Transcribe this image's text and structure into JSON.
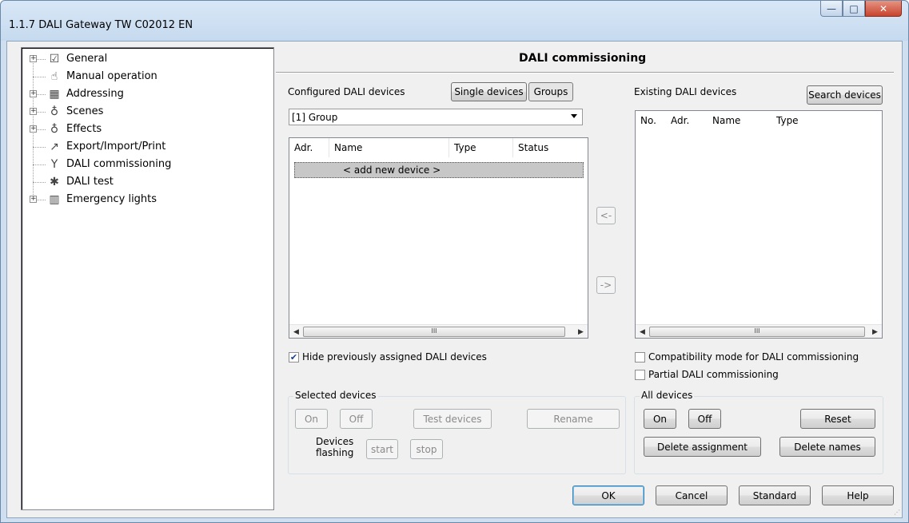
{
  "window": {
    "title": "1.1.7 DALI Gateway TW C02012 EN",
    "minimize_glyph": "—",
    "maximize_glyph": "□",
    "close_glyph": "✕"
  },
  "tree": {
    "expander_glyph": "+",
    "items": [
      {
        "label": "General",
        "icon": "checklist-icon",
        "glyph": "☑",
        "expandable": true
      },
      {
        "label": "Manual operation",
        "icon": "hand-icon",
        "glyph": "☝",
        "expandable": false
      },
      {
        "label": "Addressing",
        "icon": "grid-icon",
        "glyph": "▦",
        "expandable": true
      },
      {
        "label": "Scenes",
        "icon": "bulb-icon",
        "glyph": "♁",
        "expandable": true
      },
      {
        "label": "Effects",
        "icon": "bulb-icon",
        "glyph": "♁",
        "expandable": true
      },
      {
        "label": "Export/Import/Print",
        "icon": "export-icon",
        "glyph": "↗",
        "expandable": false
      },
      {
        "label": "DALI commissioning",
        "icon": "wrench-icon",
        "glyph": "Y",
        "expandable": false
      },
      {
        "label": "DALI test",
        "icon": "gear-icon",
        "glyph": "✱",
        "expandable": false
      },
      {
        "label": "Emergency lights",
        "icon": "emergency-exit-icon",
        "glyph": "▥",
        "expandable": true
      }
    ]
  },
  "main": {
    "heading": "DALI commissioning",
    "configured": {
      "label": "Configured DALI devices",
      "tab_single": "Single devices",
      "tab_groups": "Groups",
      "group_select": "[1] Group",
      "columns": [
        "Adr.",
        "Name",
        "Type",
        "Status"
      ],
      "add_row": "< add new device >",
      "scroll_left": "◀",
      "scroll_right": "▶",
      "scroll_thumb": "III",
      "hide_assigned": "Hide previously assigned DALI devices",
      "hide_assigned_checked": true,
      "check_glyph": "✔"
    },
    "transfer": {
      "left": "<-",
      "right": "->"
    },
    "existing": {
      "label": "Existing DALI devices",
      "search": "Search devices",
      "columns": [
        "No.",
        "Adr.",
        "Name",
        "Type"
      ],
      "compat": "Compatibility mode for DALI commissioning",
      "partial": "Partial DALI commissioning"
    },
    "selected_devices": {
      "title": "Selected devices",
      "on": "On",
      "off": "Off",
      "test": "Test devices",
      "rename": "Rename",
      "flashing_line1": "Devices",
      "flashing_line2": "flashing",
      "start": "start",
      "stop": "stop"
    },
    "all_devices": {
      "title": "All devices",
      "on": "On",
      "off": "Off",
      "reset": "Reset",
      "delete_assignment": "Delete assignment",
      "delete_names": "Delete names"
    }
  },
  "footer": {
    "ok": "OK",
    "cancel": "Cancel",
    "standard": "Standard",
    "help": "Help"
  }
}
